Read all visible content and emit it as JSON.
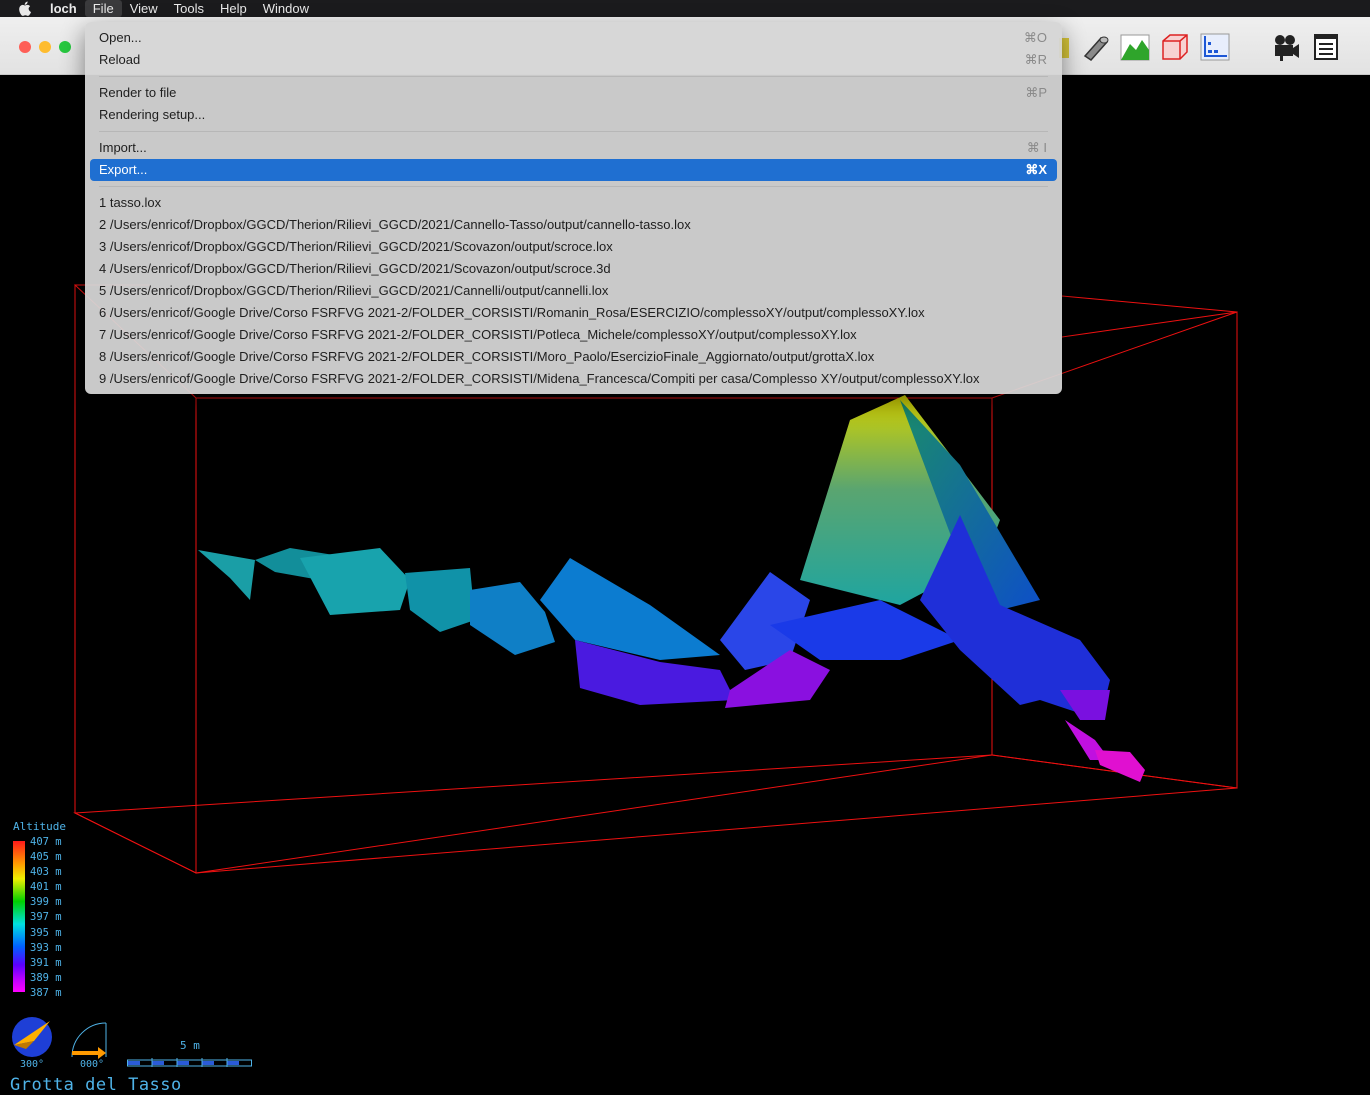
{
  "menubar": {
    "app_name": "loch",
    "items": [
      "File",
      "View",
      "Tools",
      "Help",
      "Window"
    ]
  },
  "toolbar": {
    "icons": [
      "map-color-icon",
      "tube-icon",
      "surface-icon",
      "box-icon",
      "walls-icon",
      "camera-icon",
      "info-icon"
    ]
  },
  "file_menu": {
    "items": [
      {
        "label": "Open...",
        "shortcut": "⌘O"
      },
      {
        "label": "Reload",
        "shortcut": "⌘R"
      },
      {
        "label": "Render to file",
        "shortcut": "⌘P"
      },
      {
        "label": "Rendering setup...",
        "shortcut": ""
      },
      {
        "label": "Import...",
        "shortcut": "⌘ I"
      },
      {
        "label": "Export...",
        "shortcut": "⌘X"
      }
    ],
    "recent": [
      "1 tasso.lox",
      "2 /Users/enricof/Dropbox/GGCD/Therion/Rilievi_GGCD/2021/Cannello-Tasso/output/cannello-tasso.lox",
      "3 /Users/enricof/Dropbox/GGCD/Therion/Rilievi_GGCD/2021/Scovazon/output/scroce.lox",
      "4 /Users/enricof/Dropbox/GGCD/Therion/Rilievi_GGCD/2021/Scovazon/output/scroce.3d",
      "5 /Users/enricof/Dropbox/GGCD/Therion/Rilievi_GGCD/2021/Cannelli/output/cannelli.lox",
      "6 /Users/enricof/Google Drive/Corso FSRFVG 2021-2/FOLDER_CORSISTI/Romanin_Rosa/ESERCIZIO/complessoXY/output/complessoXY.lox",
      "7 /Users/enricof/Google Drive/Corso FSRFVG 2021-2/FOLDER_CORSISTI/Potleca_Michele/complessoXY/output/complessoXY.lox",
      "8 /Users/enricof/Google Drive/Corso FSRFVG 2021-2/FOLDER_CORSISTI/Moro_Paolo/EsercizioFinale_Aggiornato/output/grottaX.lox",
      "9 /Users/enricof/Google Drive/Corso FSRFVG 2021-2/FOLDER_CORSISTI/Midena_Francesca/Compiti per casa/Complesso XY/output/complessoXY.lox"
    ]
  },
  "legend": {
    "title": "Altitude",
    "labels": [
      "407 m",
      "405 m",
      "403 m",
      "401 m",
      "399 m",
      "397 m",
      "395 m",
      "393 m",
      "391 m",
      "389 m",
      "387 m"
    ]
  },
  "compass": {
    "heading": "300°",
    "inclination": "000°"
  },
  "scale": {
    "label": "5 m"
  },
  "cave_title": "Grotta del Tasso"
}
